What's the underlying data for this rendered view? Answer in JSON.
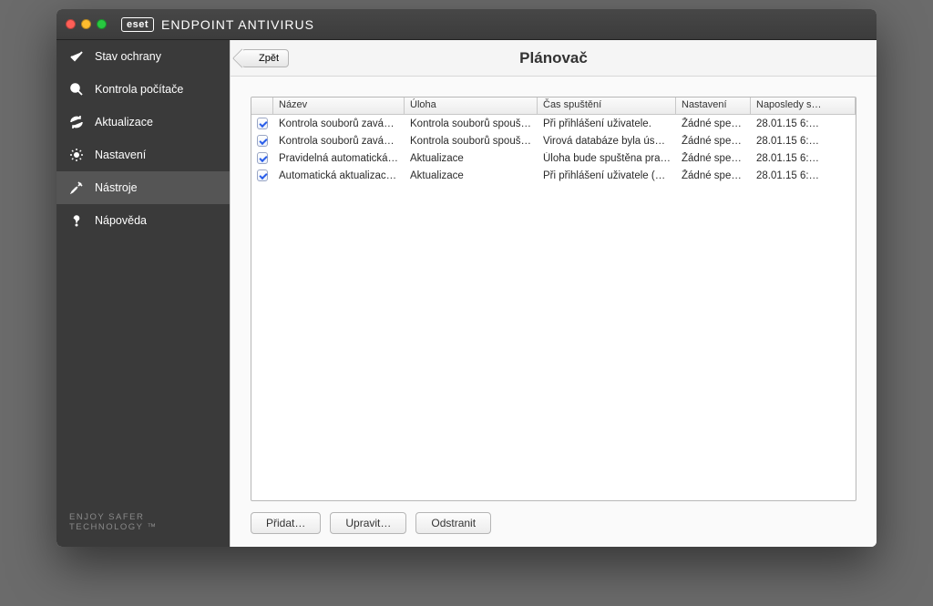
{
  "titlebar": {
    "logo": "eset",
    "title": "ENDPOINT ANTIVIRUS"
  },
  "sidebar": {
    "items": [
      {
        "id": "status",
        "icon": "check-icon",
        "label": "Stav ochrany"
      },
      {
        "id": "scan",
        "icon": "magnify-icon",
        "label": "Kontrola počítače"
      },
      {
        "id": "update",
        "icon": "refresh-icon",
        "label": "Aktualizace"
      },
      {
        "id": "settings",
        "icon": "gear-icon",
        "label": "Nastavení"
      },
      {
        "id": "tools",
        "icon": "tools-icon",
        "label": "Nástroje",
        "active": true
      },
      {
        "id": "help",
        "icon": "question-icon",
        "label": "Nápověda"
      }
    ],
    "footer": "ENJOY SAFER TECHNOLOGY ™"
  },
  "toolbar": {
    "back_label": "Zpět"
  },
  "page": {
    "title": "Plánovač"
  },
  "table": {
    "columns": {
      "name": "Název",
      "task": "Úloha",
      "time": "Čas spuštění",
      "settings": "Nastavení",
      "last": "Naposledy s…"
    },
    "rows": [
      {
        "checked": true,
        "name": "Kontrola souborů zavá…",
        "task": "Kontrola souborů spouš…",
        "time": "Při přihlášení uživatele.",
        "settings": "Žádné speci…",
        "last": "28.01.15 6:…"
      },
      {
        "checked": true,
        "name": "Kontrola souborů zavá…",
        "task": "Kontrola souborů spouš…",
        "time": "Virová databáze byla úsp…",
        "settings": "Žádné speci…",
        "last": "28.01.15 6:…"
      },
      {
        "checked": true,
        "name": "Pravidelná automatická…",
        "task": "Aktualizace",
        "time": "Úloha bude spuštěna pra…",
        "settings": "Žádné speci…",
        "last": "28.01.15 6:…"
      },
      {
        "checked": true,
        "name": "Automatická aktualizac…",
        "task": "Aktualizace",
        "time": "Při přihlášení uživatele (…",
        "settings": "Žádné speci…",
        "last": "28.01.15 6:…"
      }
    ]
  },
  "actions": {
    "add": "Přidat…",
    "edit": "Upravit…",
    "delete": "Odstranit"
  }
}
